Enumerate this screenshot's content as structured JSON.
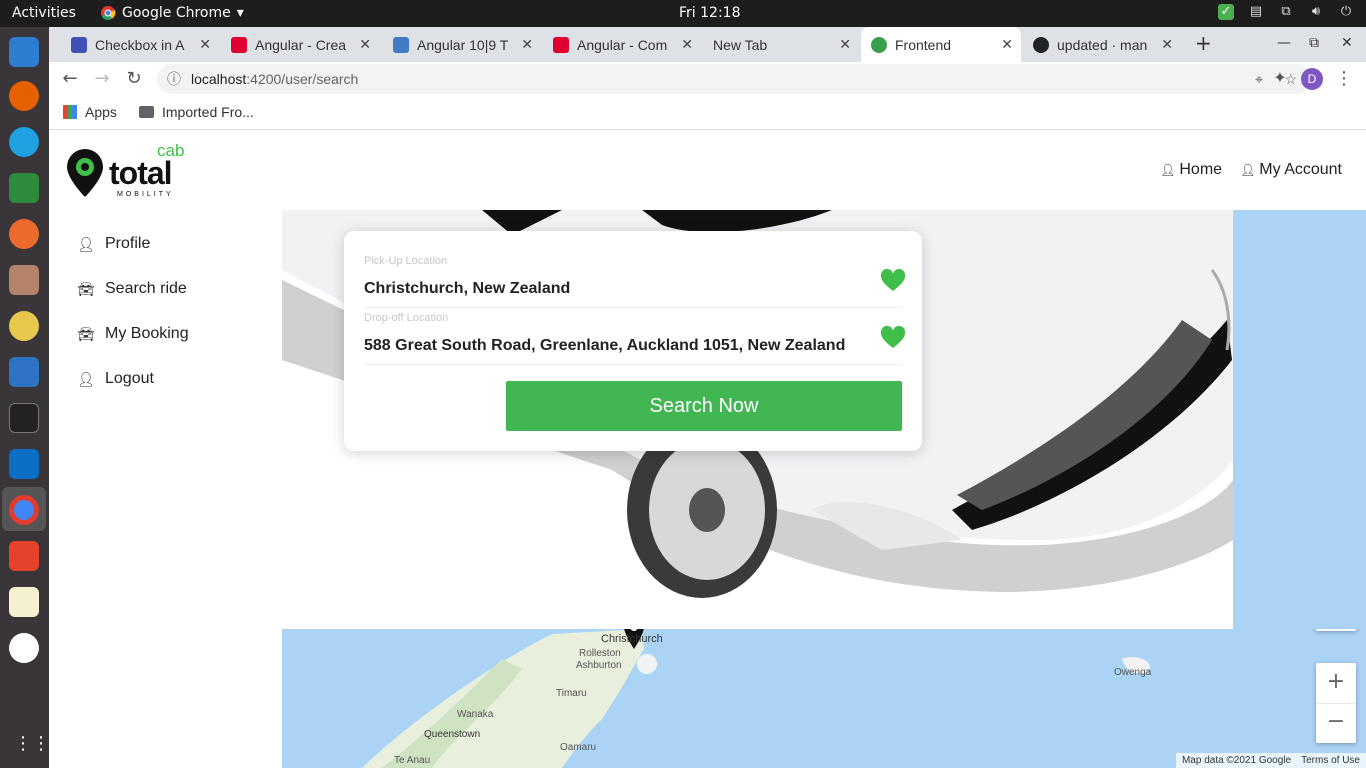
{
  "os": {
    "activities": "Activities",
    "app_name": "Google Chrome",
    "clock": "Fri 12:18"
  },
  "browser": {
    "tabs": [
      {
        "title": "Checkbox in A",
        "icon": "checkbox-site-icon",
        "color": "#3f51b5"
      },
      {
        "title": "Angular - Crea",
        "icon": "angular-icon",
        "color": "#dd0031"
      },
      {
        "title": "Angular 10|9 T",
        "icon": "tutorial-site-icon",
        "color": "#3f7cc4"
      },
      {
        "title": "Angular - Com",
        "icon": "angular-icon",
        "color": "#dd0031"
      },
      {
        "title": "New Tab",
        "icon": "",
        "color": ""
      },
      {
        "title": "Frontend",
        "icon": "frontend-icon",
        "color": "#3a9f4a"
      },
      {
        "title": "updated · man",
        "icon": "github-icon",
        "color": "#222222"
      }
    ],
    "url_host": "localhost",
    "url_path": ":4200/user/search",
    "bookmarks": [
      {
        "label": "Apps"
      },
      {
        "label": "Imported Fro..."
      }
    ],
    "avatar_letter": "D"
  },
  "site": {
    "logo_main": "total",
    "logo_sup": "cab",
    "logo_sub": "MOBILITY",
    "nav": [
      {
        "label": "Home"
      },
      {
        "label": "My Account"
      }
    ],
    "sidebar": [
      {
        "label": "Profile",
        "icon": "person-icon"
      },
      {
        "label": "Search ride",
        "icon": "car-icon"
      },
      {
        "label": "My Booking",
        "icon": "car-icon"
      },
      {
        "label": "Logout",
        "icon": "person-icon"
      }
    ]
  },
  "search_card": {
    "pickup_label": "Pick-Up Location",
    "pickup_value": "Christchurch, New Zealand",
    "dropoff_label": "Drop-off Location",
    "dropoff_value": "588 Great South Road, Greenlane, Auckland 1051, New Zealand",
    "button": "Search Now"
  },
  "map": {
    "places": [
      "Christchurch",
      "Rolleston",
      "Ashburton",
      "Timaru",
      "Wanaka",
      "Queenstown",
      "Oamaru",
      "Te Anau",
      "Owenga"
    ],
    "attribution": "Map data ©2021 Google",
    "terms": "Terms of Use"
  },
  "colors": {
    "accent": "#42b653",
    "brand_green": "#3fbf4a"
  }
}
